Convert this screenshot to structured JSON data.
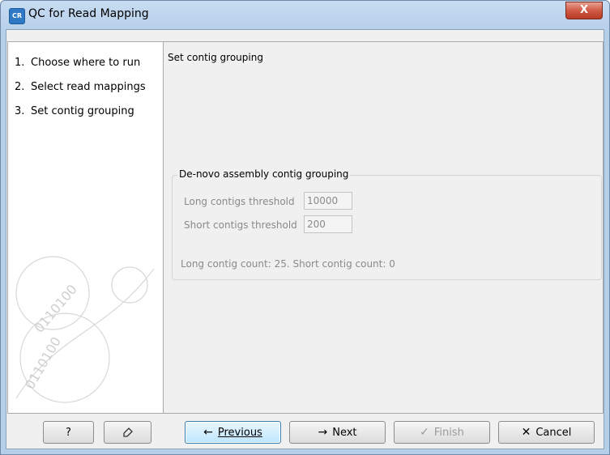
{
  "window": {
    "app_icon": "CR",
    "title": "QC for Read Mapping",
    "close_label": "X"
  },
  "steps": [
    {
      "num": "1.",
      "label": "Choose where to run"
    },
    {
      "num": "2.",
      "label": "Select read mappings"
    },
    {
      "num": "3.",
      "label": "Set contig grouping"
    }
  ],
  "panel": {
    "section_title": "Set contig grouping",
    "group_title": "De-novo assembly contig grouping",
    "long_label": "Long contigs threshold",
    "long_value": "10000",
    "short_label": "Short contigs threshold",
    "short_value": "200",
    "count_text": "Long contig count: 25. Short contig count: 0"
  },
  "buttons": {
    "help": "?",
    "reset_icon": "reset-arrow-icon",
    "previous": "Previous",
    "next": "Next",
    "finish": "Finish",
    "cancel": "Cancel"
  },
  "decoration": {
    "watermark_digits": "0110100"
  }
}
